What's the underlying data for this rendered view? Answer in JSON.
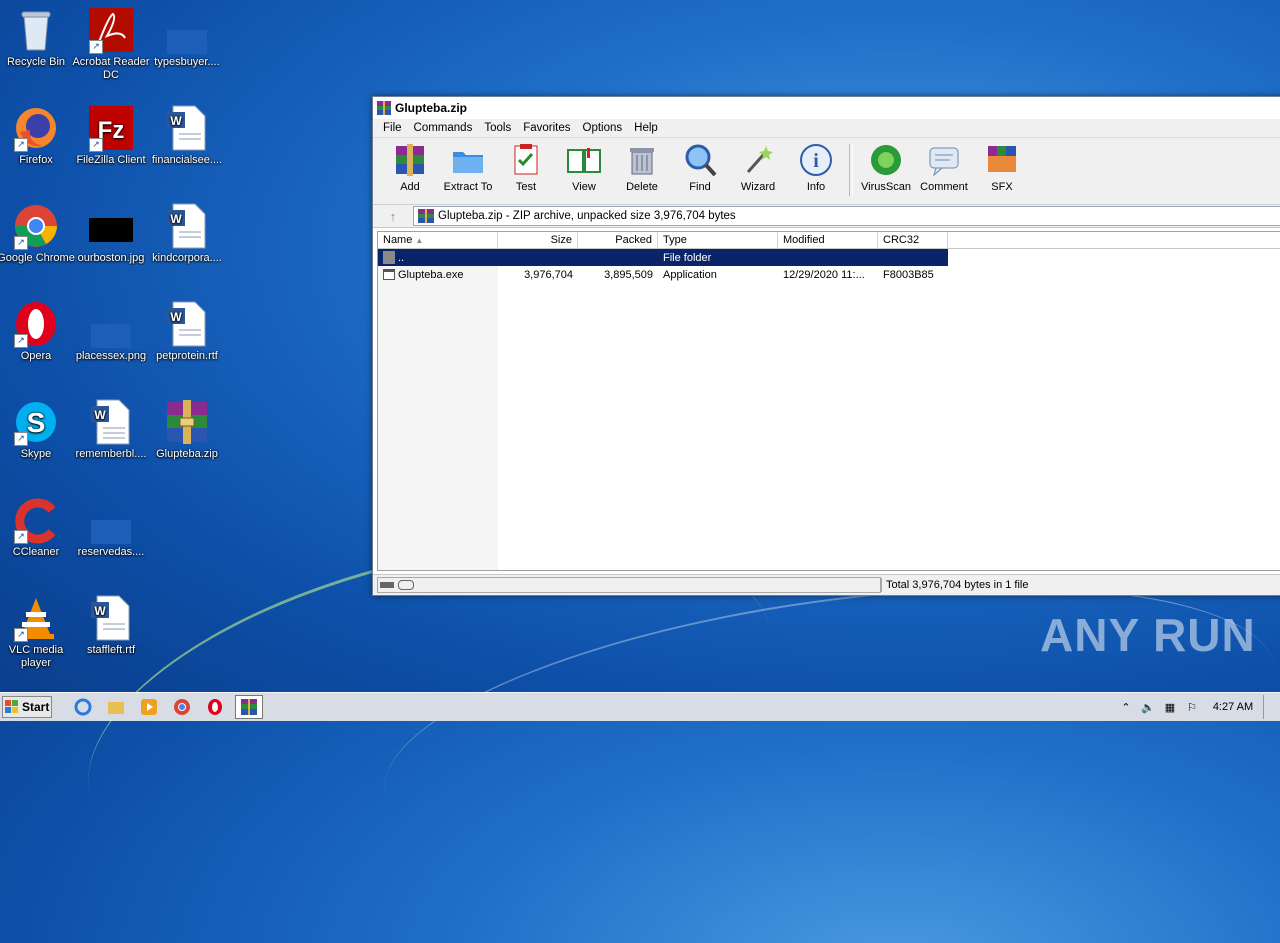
{
  "desktop": {
    "icons": [
      {
        "label": "Recycle Bin"
      },
      {
        "label": "Acrobat Reader DC"
      },
      {
        "label": "typesbuyer...."
      },
      {
        "label": "Firefox"
      },
      {
        "label": "FileZilla Client"
      },
      {
        "label": "financialsee...."
      },
      {
        "label": "Google Chrome"
      },
      {
        "label": "ourboston.jpg"
      },
      {
        "label": "kindcorpora...."
      },
      {
        "label": "Opera"
      },
      {
        "label": "placessex.png"
      },
      {
        "label": "petprotein.rtf"
      },
      {
        "label": "Skype"
      },
      {
        "label": "rememberbl...."
      },
      {
        "label": "Glupteba.zip"
      },
      {
        "label": "CCleaner"
      },
      {
        "label": "reservedas...."
      },
      {
        "label": "VLC media player"
      },
      {
        "label": "staffleft.rtf"
      }
    ]
  },
  "window": {
    "title": "Glupteba.zip",
    "menu": [
      "File",
      "Commands",
      "Tools",
      "Favorites",
      "Options",
      "Help"
    ],
    "toolbar": [
      "Add",
      "Extract To",
      "Test",
      "View",
      "Delete",
      "Find",
      "Wizard",
      "Info",
      "VirusScan",
      "Comment",
      "SFX"
    ],
    "address": "Glupteba.zip - ZIP archive, unpacked size 3,976,704 bytes",
    "columns": {
      "name": "Name",
      "size": "Size",
      "packed": "Packed",
      "type": "Type",
      "modified": "Modified",
      "crc": "CRC32"
    },
    "rows": [
      {
        "name": "..",
        "size": "",
        "packed": "",
        "type": "File folder",
        "modified": "",
        "crc": ""
      },
      {
        "name": "Glupteba.exe",
        "size": "3,976,704",
        "packed": "3,895,509",
        "type": "Application",
        "modified": "12/29/2020 11:...",
        "crc": "F8003B85"
      }
    ],
    "status": "Total 3,976,704 bytes in 1 file"
  },
  "taskbar": {
    "start": "Start",
    "clock": "4:27 AM"
  },
  "watermark": "ANY RUN"
}
